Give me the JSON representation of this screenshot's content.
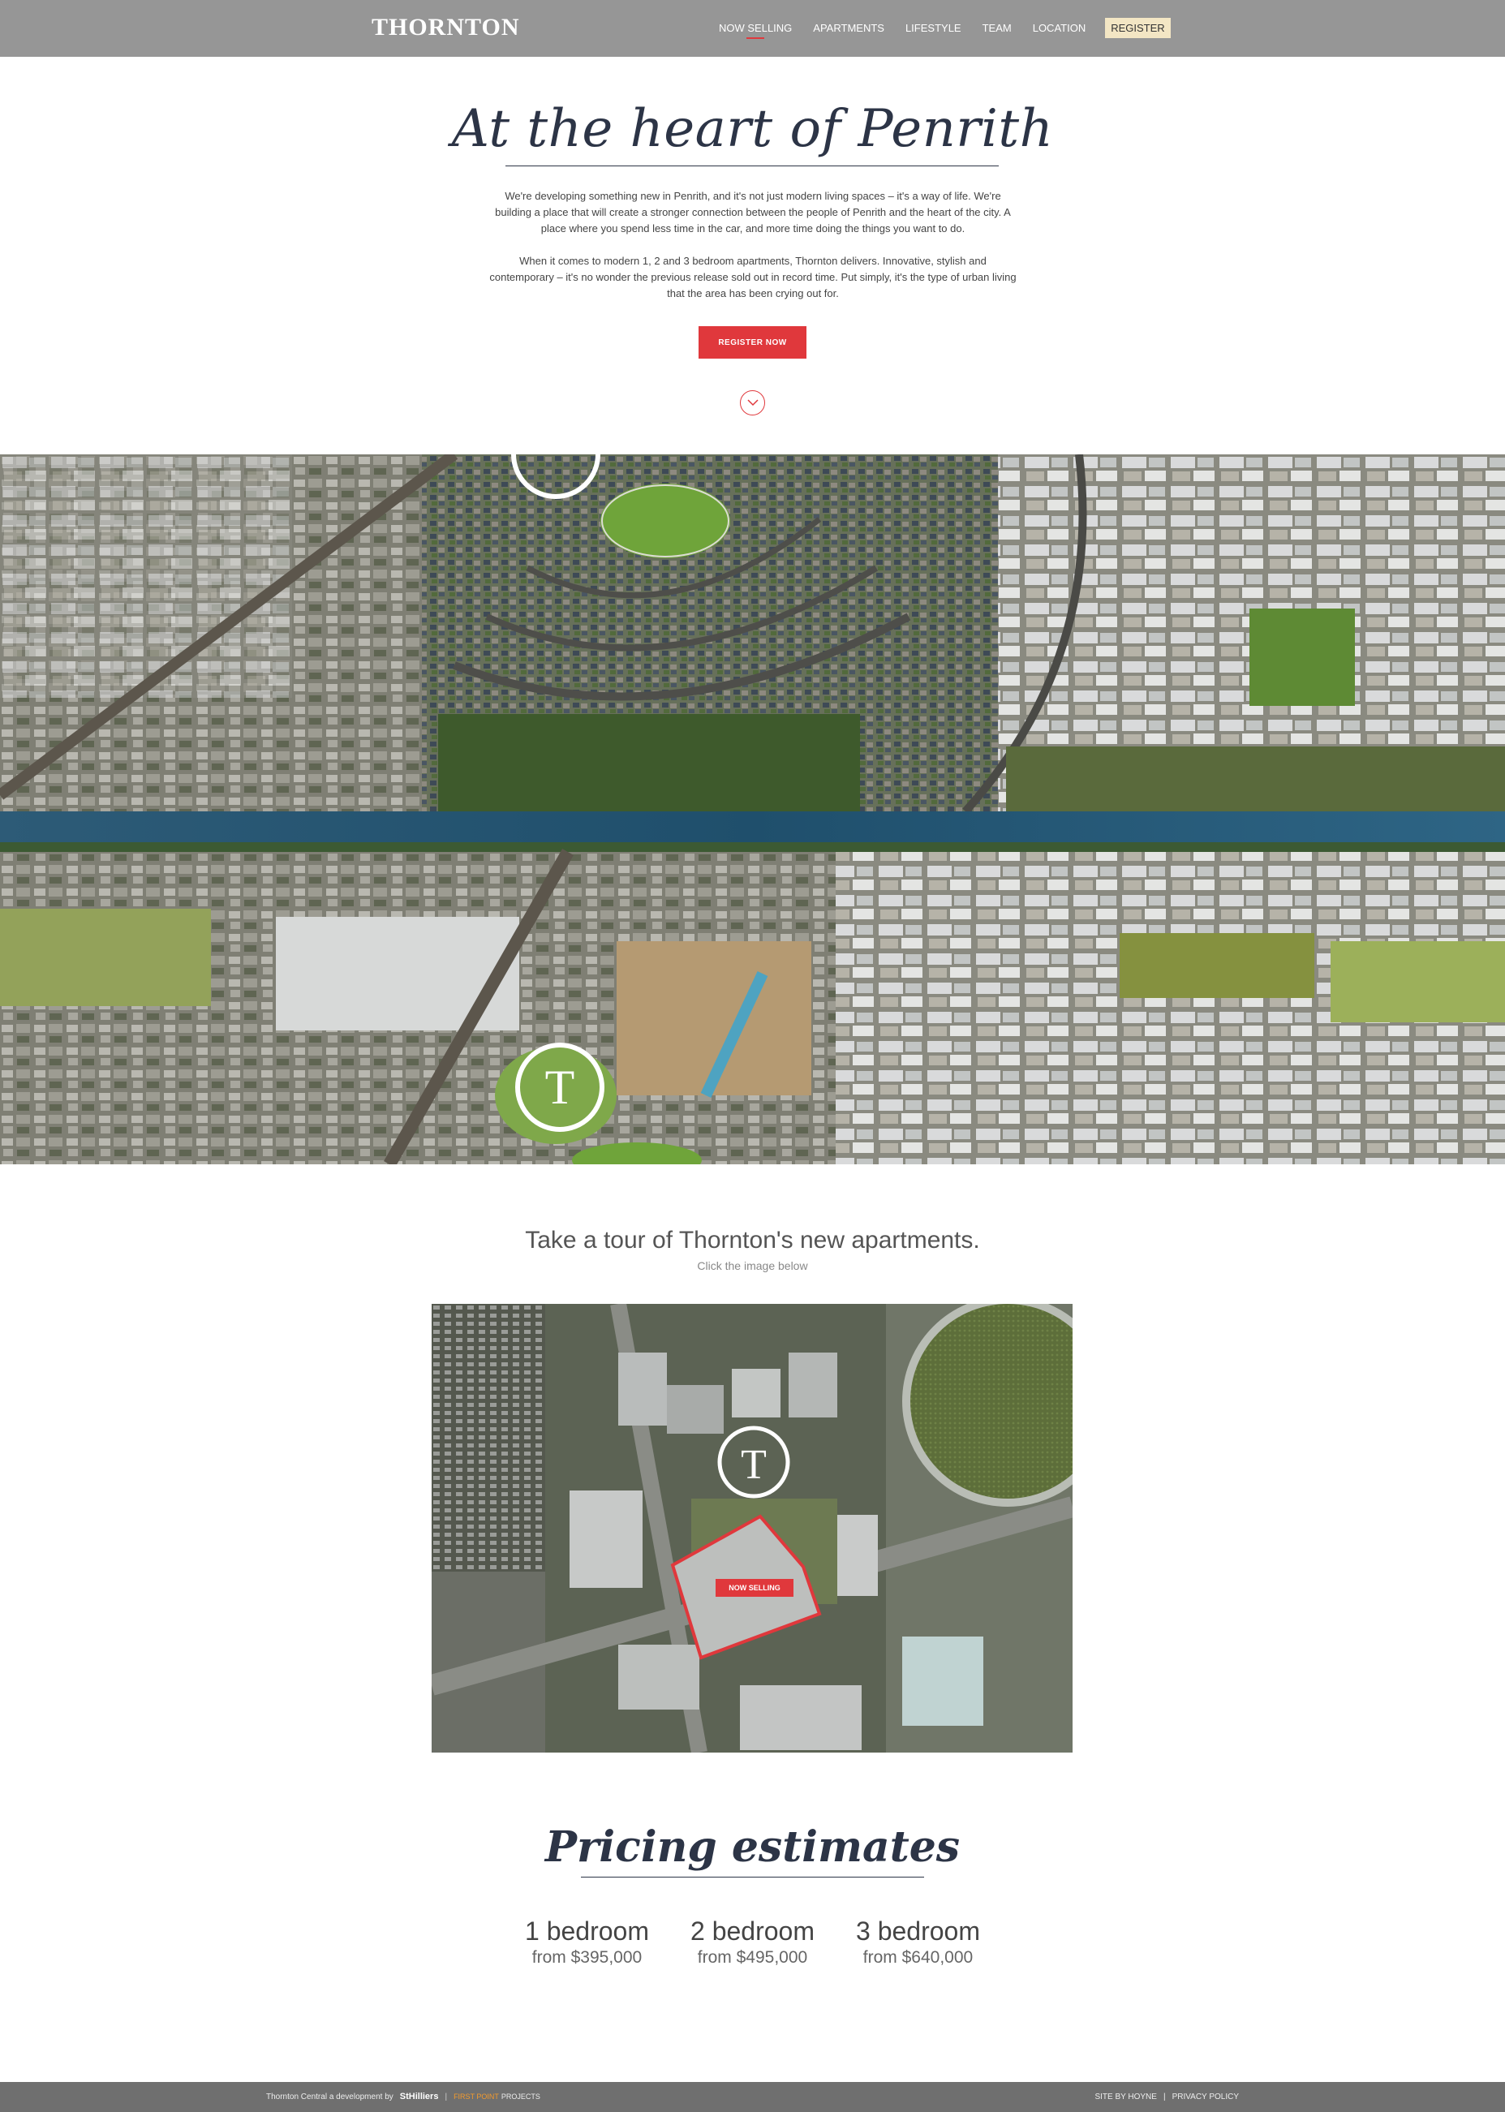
{
  "nav": {
    "logo": "THORNTON",
    "links": [
      "NOW SELLING",
      "APARTMENTS",
      "LIFESTYLE",
      "TEAM",
      "LOCATION"
    ],
    "register": "REGISTER"
  },
  "hero": {
    "title": "At the heart of Penrith",
    "paragraph1": "We're developing something new in Penrith, and it's not just modern living spaces – it's a way of life. We're building a place that will create a stronger connection between the people of Penrith and the heart of the city. A place where you spend less time in the car, and more time doing the things you want to do.",
    "paragraph2": "When it comes to modern 1, 2 and 3 bedroom apartments, Thornton delivers. Innovative, stylish and contemporary – it's no wonder the previous release sold out in record time. Put simply, it's the type of urban living that the area has been crying out for.",
    "button": "REGISTER NOW"
  },
  "aerial": {
    "marker_letter": "T"
  },
  "tour": {
    "title": "Take a tour of Thornton's new apartments.",
    "subtitle": "Click the image below",
    "marker_letter": "T",
    "now_selling": "NOW SELLING"
  },
  "pricing": {
    "title": "Pricing estimates",
    "items": [
      {
        "bed": "1 bedroom",
        "price": "from $395,000"
      },
      {
        "bed": "2 bedroom",
        "price": "from $495,000"
      },
      {
        "bed": "3 bedroom",
        "price": "from $640,000"
      }
    ]
  },
  "footer": {
    "credit": "Thornton Central a development by",
    "brand1": "StHilliers",
    "brand2": "FIRST POINT",
    "brand2b": "PROJECTS",
    "site_by": "SITE BY HOYNE",
    "privacy": "PRIVACY POLICY"
  }
}
